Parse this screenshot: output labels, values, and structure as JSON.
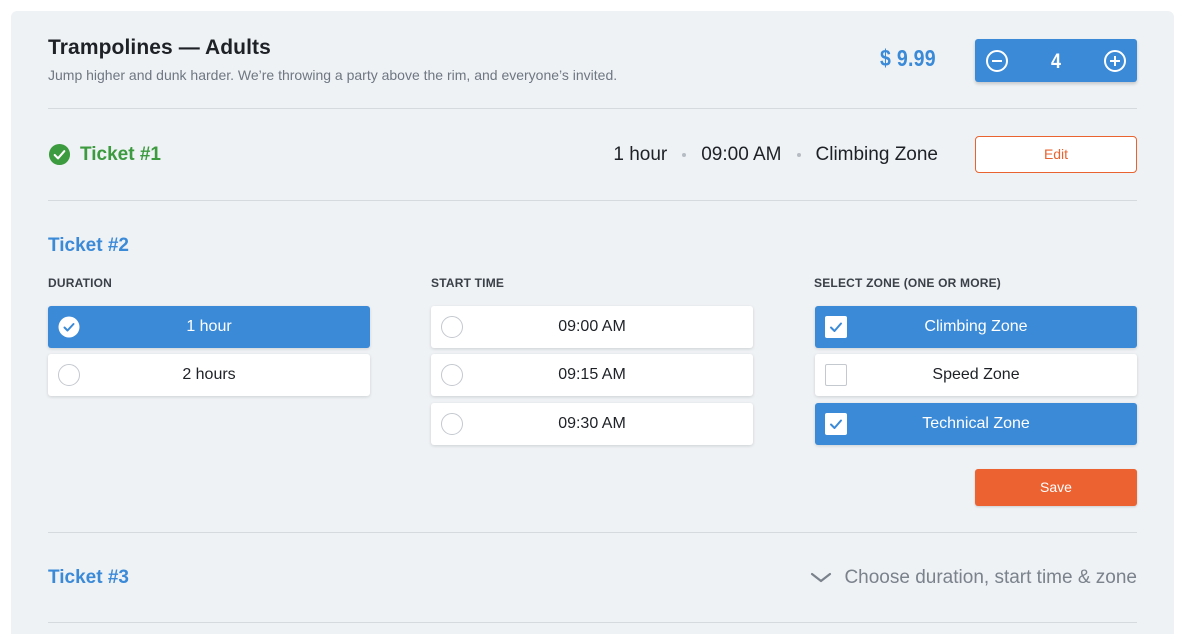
{
  "product": {
    "title": "Trampolines — Adults",
    "description": "Jump higher and dunk harder. We’re throwing a party above the rim, and everyone’s invited.",
    "price": "$ 9.99",
    "quantity": "4",
    "stepper_icons": {
      "decrement": "minus-circle-icon",
      "increment": "plus-circle-icon"
    }
  },
  "ticket1": {
    "title": "Ticket #1",
    "status_icon": "check-circle-icon",
    "duration": "1 hour",
    "start_time": "09:00 AM",
    "zone": "Climbing Zone",
    "edit_label": "Edit"
  },
  "ticket2": {
    "title": "Ticket #2",
    "duration_label": "DURATION",
    "start_time_label": "START TIME",
    "zone_label": "SELECT ZONE (ONE OR MORE)",
    "durations": [
      {
        "label": "1 hour",
        "selected": true
      },
      {
        "label": "2 hours",
        "selected": false
      }
    ],
    "start_times": [
      {
        "label": "09:00 AM",
        "selected": false
      },
      {
        "label": "09:15 AM",
        "selected": false
      },
      {
        "label": "09:30 AM",
        "selected": false
      }
    ],
    "zones": [
      {
        "label": "Climbing Zone",
        "checked": true
      },
      {
        "label": "Speed Zone",
        "checked": false
      },
      {
        "label": "Technical Zone",
        "checked": true
      }
    ],
    "save_label": "Save"
  },
  "ticket3": {
    "title": "Ticket #3",
    "hint": "Choose duration, start time & zone",
    "expand_icon": "chevron-down-icon"
  },
  "colors": {
    "accent_blue": "#3a8ad8",
    "success_green": "#3c9a3f",
    "action_orange": "#ec6231",
    "panel_bg": "#eff2f5"
  }
}
